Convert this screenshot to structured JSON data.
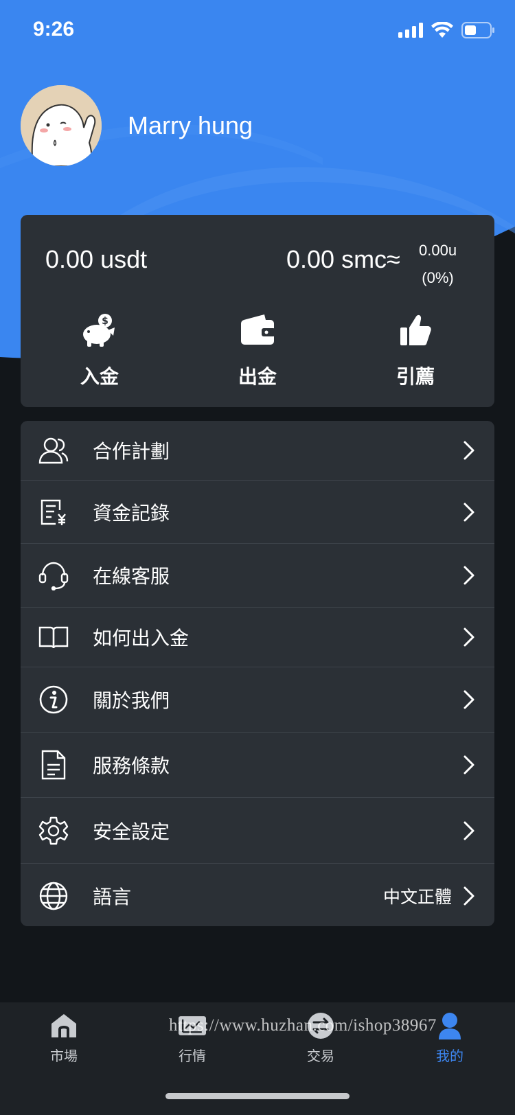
{
  "colors": {
    "header_blue": "#3a86f0",
    "background": "#12161a",
    "card": "#2b3036",
    "active_tab": "#3d86f0"
  },
  "status_bar": {
    "time": "9:26",
    "icons": [
      "signal-icon",
      "wifi-icon",
      "battery-icon"
    ]
  },
  "profile": {
    "username": "Marry hung",
    "avatar": "waving-ghost-avatar"
  },
  "wallet": {
    "usdt_balance": "0.00 usdt",
    "smc_balance": "0.00 smc≈",
    "smc_value": "0.00u",
    "smc_change": "(0%)",
    "actions": [
      {
        "label": "入金",
        "icon": "piggy-bank-icon"
      },
      {
        "label": "出金",
        "icon": "wallet-icon"
      },
      {
        "label": "引薦",
        "icon": "thumbs-up-icon"
      }
    ]
  },
  "menu": {
    "items": [
      {
        "label": "合作計劃",
        "icon": "users-icon"
      },
      {
        "label": "資金記錄",
        "icon": "fund-record-icon"
      },
      {
        "label": "在線客服",
        "icon": "headset-icon"
      },
      {
        "label": "如何出入金",
        "icon": "book-icon"
      },
      {
        "label": "關於我們",
        "icon": "info-icon"
      },
      {
        "label": "服務條款",
        "icon": "document-icon"
      },
      {
        "label": "安全設定",
        "icon": "gear-icon"
      },
      {
        "label": "語言",
        "icon": "globe-icon",
        "value": "中文正體"
      }
    ]
  },
  "tabbar": {
    "tabs": [
      {
        "label": "市場",
        "icon": "market-icon",
        "active": false
      },
      {
        "label": "行情",
        "icon": "chart-icon",
        "active": false
      },
      {
        "label": "交易",
        "icon": "exchange-icon",
        "active": false
      },
      {
        "label": "我的",
        "icon": "user-icon",
        "active": true
      }
    ]
  },
  "watermark": "https://www.huzhan.com/ishop38967"
}
